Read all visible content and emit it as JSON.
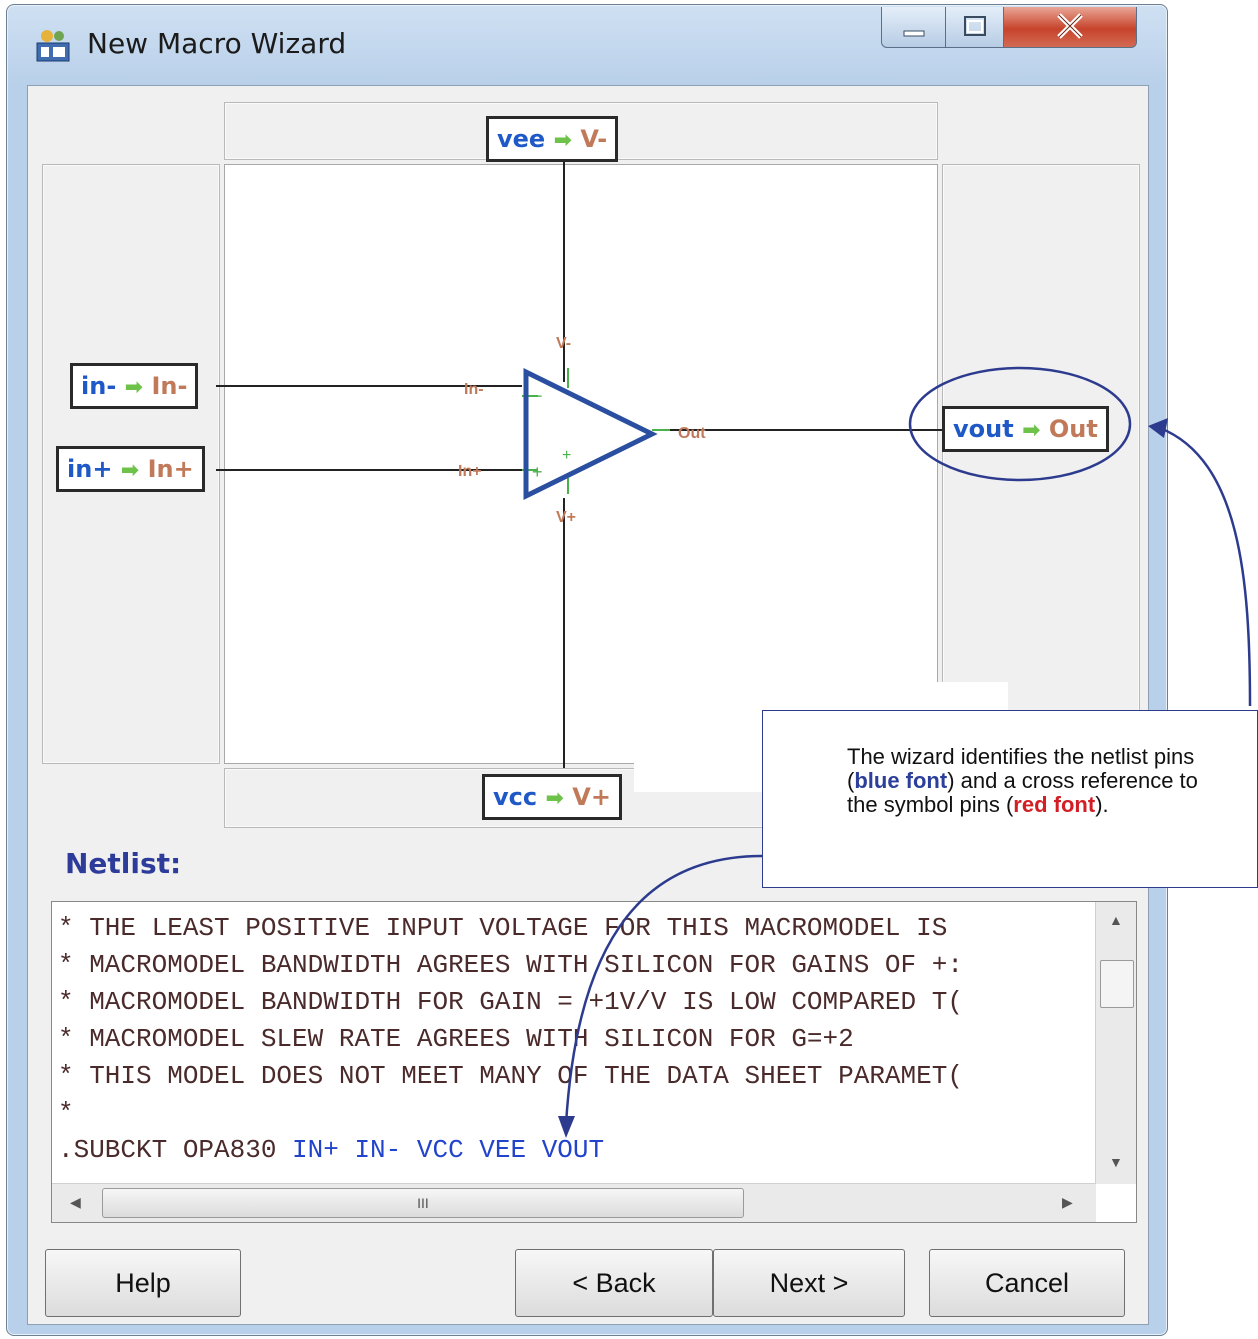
{
  "window": {
    "title": "New Macro Wizard",
    "icon": "macro-wizard-icon"
  },
  "symbol": {
    "pins": [
      {
        "net": "vee",
        "symbol": "V-"
      },
      {
        "net": "in-",
        "symbol": "In-"
      },
      {
        "net": "in+",
        "symbol": "In+"
      },
      {
        "net": "vout",
        "symbol": "Out"
      },
      {
        "net": "vcc",
        "symbol": "V+"
      }
    ],
    "arrow": "➡",
    "opamp_labels": {
      "v_minus": "V-",
      "in_minus": "In-",
      "in_plus": "In+",
      "v_plus": "V+",
      "out": "Out",
      "minus_sign": "−",
      "plus_sign": "+"
    }
  },
  "netlist": {
    "label": "Netlist:",
    "lines": [
      "* THE LEAST POSITIVE INPUT VOLTAGE FOR THIS MACROMODEL IS",
      "* MACROMODEL BANDWIDTH AGREES WITH SILICON FOR GAINS OF +:",
      "* MACROMODEL BANDWIDTH FOR GAIN = +1V/V IS LOW COMPARED T(",
      "* MACROMODEL SLEW RATE AGREES WITH SILICON FOR G=+2",
      "* THIS MODEL DOES NOT MEET MANY OF THE DATA SHEET PARAMET(",
      "*"
    ],
    "subckt_prefix": ".SUBCKT OPA830 ",
    "subckt_pins": "IN+ IN- VCC VEE VOUT",
    "hscroll_grip": "III"
  },
  "buttons": {
    "help": "Help",
    "back": "< Back",
    "next": "Next >",
    "cancel": "Cancel"
  },
  "callout": {
    "part1": "The wizard identifies the netlist pins (",
    "blue": "blue font",
    "part2": ") and a cross reference to the symbol pins (",
    "red": "red font",
    "part3": ")."
  },
  "colors": {
    "net_pin": "#1f58c7",
    "symbol_pin": "#c07a5a",
    "annotation": "#2d3b8f",
    "opamp": "#2a4ea0"
  }
}
